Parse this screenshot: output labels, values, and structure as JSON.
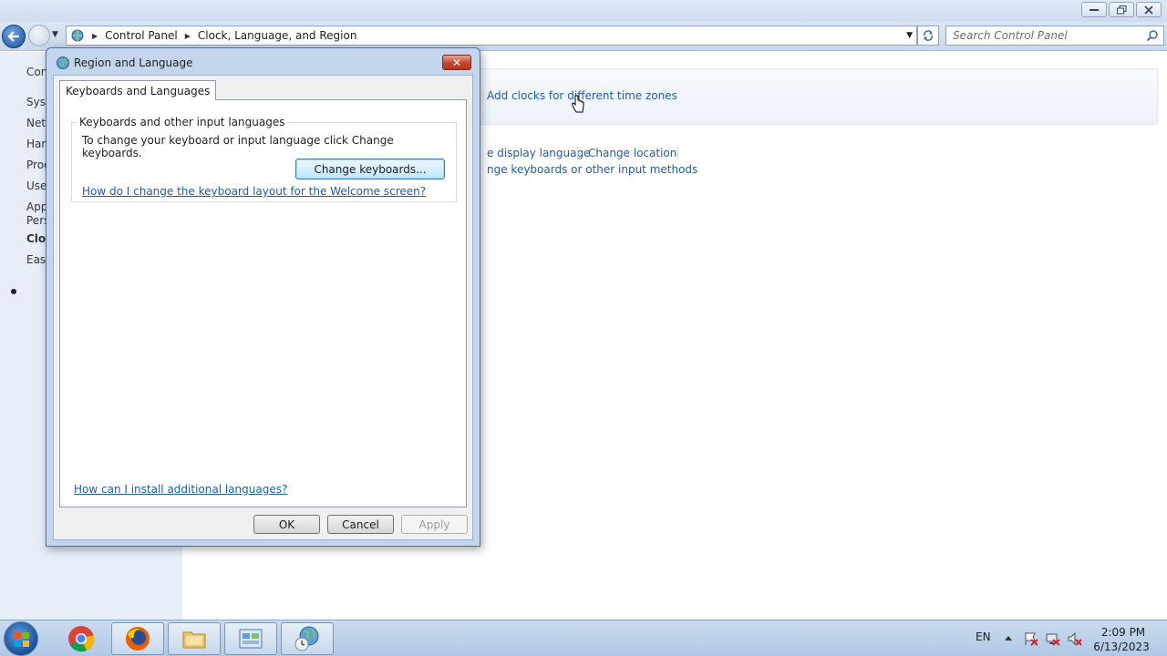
{
  "address_bar": {
    "segments": [
      "Control Panel",
      "Clock, Language, and Region"
    ],
    "search_placeholder": "Search Control Panel"
  },
  "sidebar": {
    "items": [
      "Con",
      "Syst",
      "Netv",
      "Hard",
      "Prog",
      "User",
      "App",
      "Pers",
      "Cloc",
      "Ease"
    ]
  },
  "content": {
    "links": [
      "Add clocks for different time zones",
      "e display language",
      "Change location",
      "nge keyboards or other input methods"
    ]
  },
  "dialog": {
    "title": "Region and Language",
    "close_label": "✕",
    "tab": "Keyboards and Languages",
    "group_label": "Keyboards and other input languages",
    "group_description": "To change your keyboard or input language click Change keyboards.",
    "change_keyboards_button": "Change keyboards...",
    "welcome_link": "How do I change the keyboard layout for the Welcome screen?",
    "install_link": "How can I install additional languages?",
    "ok_button": "OK",
    "cancel_button": "Cancel",
    "apply_button": "Apply"
  },
  "taskbar": {
    "language": "EN",
    "time": "2:09 PM",
    "date": "6/13/2023"
  },
  "colors": {
    "link": "#1d5ea8",
    "sidebar_bg": "#e7eef8",
    "dialog_frame": "#c4d6ee"
  }
}
